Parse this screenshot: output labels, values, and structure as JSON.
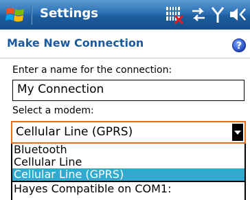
{
  "titlebar": {
    "title": "Settings",
    "start_icon": "windows-flag-icon",
    "status_icons": [
      "sim-missing-icon",
      "connectivity-icon",
      "signal-icon",
      "volume-icon"
    ]
  },
  "header": {
    "title": "Make New Connection",
    "help_icon": "help-icon"
  },
  "form": {
    "name_label": "Enter a name for the connection:",
    "name_value": "My Connection",
    "modem_label": "Select a modem:",
    "modem_selected": "Cellular Line (GPRS)",
    "modem_options": [
      "Bluetooth",
      "Cellular Line",
      "Cellular Line (GPRS)",
      "Hayes Compatible on COM1:"
    ]
  },
  "colors": {
    "titlebar": "#2c6fb3",
    "header_text": "#1c5a9e",
    "focus_border": "#e27022",
    "selection": "#32a9cf"
  }
}
